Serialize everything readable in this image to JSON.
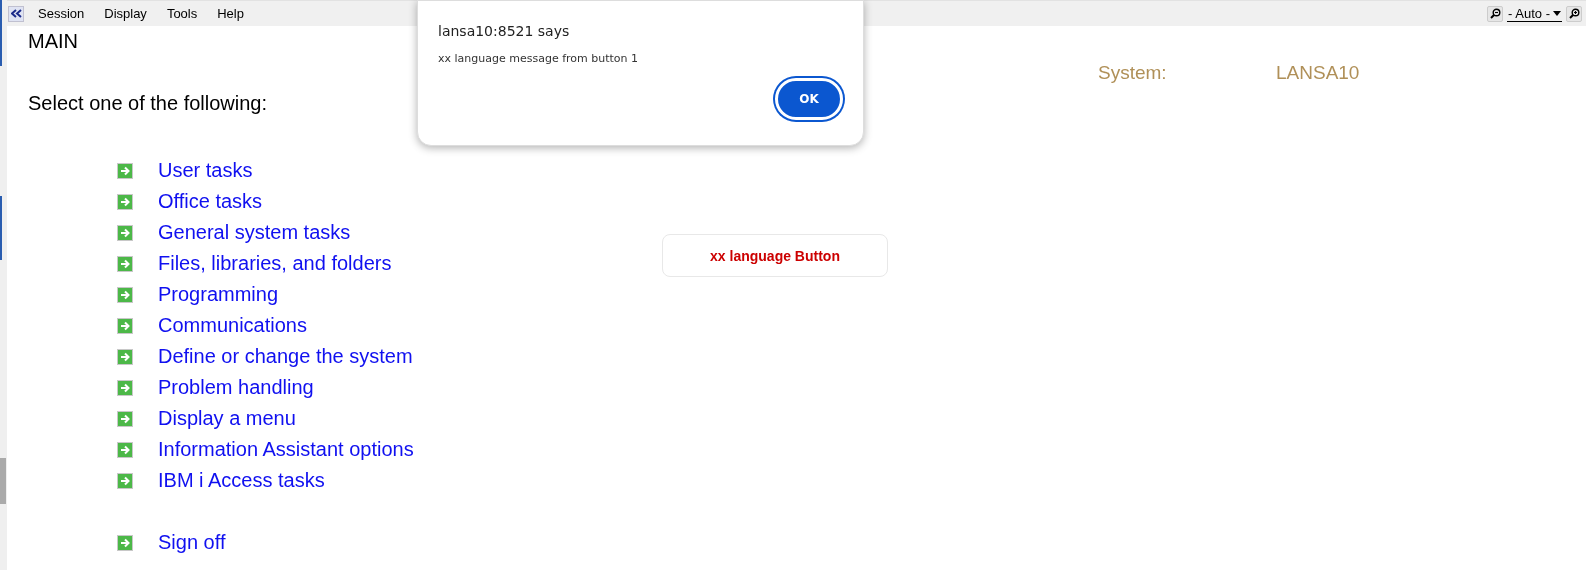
{
  "menu_bar": {
    "items": [
      "Session",
      "Display",
      "Tools",
      "Help"
    ],
    "zoom_select": "- Auto -"
  },
  "screen": {
    "title": "MAIN",
    "system_label": "System:",
    "system_value": "LANSA10",
    "prompt": "Select one of the following:",
    "options": [
      {
        "label": "User tasks"
      },
      {
        "label": "Office tasks"
      },
      {
        "label": "General system tasks"
      },
      {
        "label": "Files, libraries, and folders"
      },
      {
        "label": "Programming"
      },
      {
        "label": "Communications"
      },
      {
        "label": "Define or change the system"
      },
      {
        "label": "Problem handling"
      },
      {
        "label": "Display a menu"
      },
      {
        "label": "Information Assistant options"
      },
      {
        "label": "IBM i Access tasks"
      }
    ],
    "signoff": {
      "label": "Sign off"
    },
    "custom_button": "xx language Button"
  },
  "dialog": {
    "title": "lansa10:8521 says",
    "message": "xx language message from button 1",
    "button": "OK"
  }
}
